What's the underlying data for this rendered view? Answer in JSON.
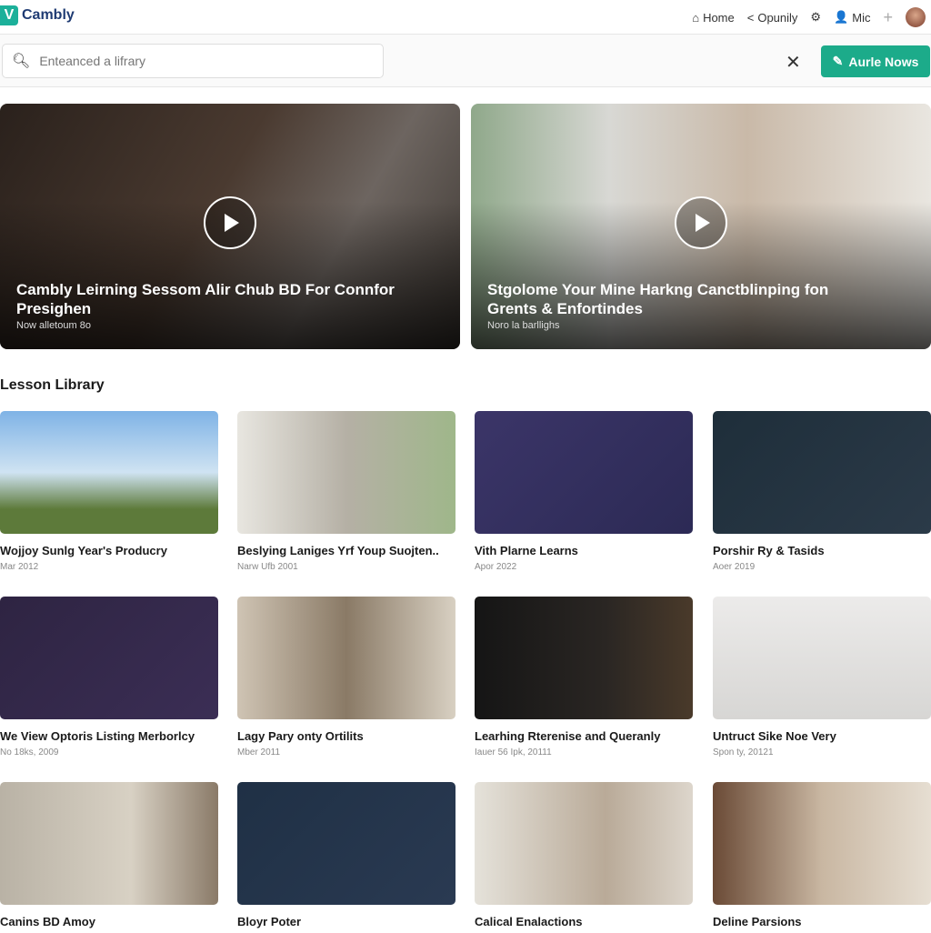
{
  "header": {
    "logo": "Cambly",
    "nav": [
      {
        "label": "Home",
        "icon": "home-icon"
      },
      {
        "label": "Opunily",
        "icon": "share-icon"
      },
      {
        "label": "",
        "icon": "gear-icon"
      },
      {
        "label": "Mic",
        "icon": "user-icon"
      },
      {
        "label": "",
        "icon": "plus-icon"
      }
    ]
  },
  "toolbar": {
    "search_placeholder": "Enteanced a lifrary",
    "cta_label": "Aurle Nows"
  },
  "featured": [
    {
      "title": "Cambly Leirning Sessom Alir Chub BD For Connfor Presighen",
      "subtitle": "Now alletoum 8o"
    },
    {
      "title": "Stgolome Your Mine Harkng Canctblinping fon Grents & Enfortindes",
      "subtitle": "Noro la barllighs"
    }
  ],
  "library": {
    "title": "Lesson Library",
    "items": [
      {
        "title": "Wojjoy Sunlg Year's Producry",
        "date": "Mar 2012"
      },
      {
        "title": "Beslying Laniges Yrf Youp Suojten..",
        "date": "Narw Ufb 2001"
      },
      {
        "title": "Vith Plarne Learns",
        "date": "Apor 2022"
      },
      {
        "title": "Porshir Ry & Tasids",
        "date": "Aoer 2019"
      },
      {
        "title": "We View Optoris Listing Merborlcy",
        "date": "No 18ks, 2009"
      },
      {
        "title": "Lagy Pary onty Ortilits",
        "date": "Mber 2011"
      },
      {
        "title": "Learhing Rterenise and Queranly",
        "date": "Iauer 56 Ipk, 20111"
      },
      {
        "title": "Untruct Sike Noe Very",
        "date": "Spon ty, 20121"
      },
      {
        "title": "Canins BD Amoy",
        "date": ""
      },
      {
        "title": "Bloyr Poter",
        "date": ""
      },
      {
        "title": "Calical Enalactions",
        "date": ""
      },
      {
        "title": "Deline Parsions",
        "date": ""
      }
    ]
  },
  "colors": {
    "accent": "#1cab8a",
    "brand": "#1f3b73"
  }
}
